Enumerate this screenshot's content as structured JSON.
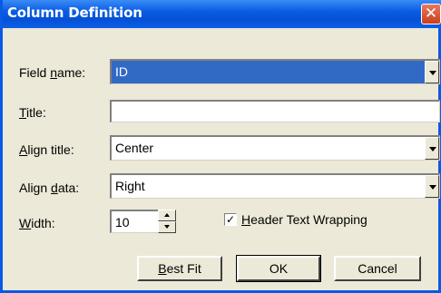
{
  "window": {
    "title": "Column Definition",
    "close_glyph": "✕"
  },
  "fields": {
    "field_name": {
      "label_prefix": "Field ",
      "label_hotkey": "n",
      "label_suffix": "ame:",
      "value": "ID"
    },
    "title": {
      "label_hotkey": "T",
      "label_suffix": "itle:",
      "value": ""
    },
    "align_title": {
      "label_hotkey": "A",
      "label_suffix": "lign title:",
      "value": "Center"
    },
    "align_data": {
      "label_prefix": "Align ",
      "label_hotkey": "d",
      "label_suffix": "ata:",
      "value": "Right"
    },
    "width": {
      "label_hotkey": "W",
      "label_suffix": "idth:",
      "value": "10"
    }
  },
  "header_wrap": {
    "label_hotkey": "H",
    "label_suffix": "eader Text Wrapping",
    "checked": true,
    "check_glyph": "✓"
  },
  "buttons": {
    "best_fit": {
      "hotkey": "B",
      "rest": "est Fit"
    },
    "ok": "OK",
    "cancel": "Cancel"
  },
  "icons": [
    "close-icon",
    "dropdown-arrow-icon",
    "spin-up-icon",
    "spin-down-icon",
    "checkmark-icon"
  ]
}
